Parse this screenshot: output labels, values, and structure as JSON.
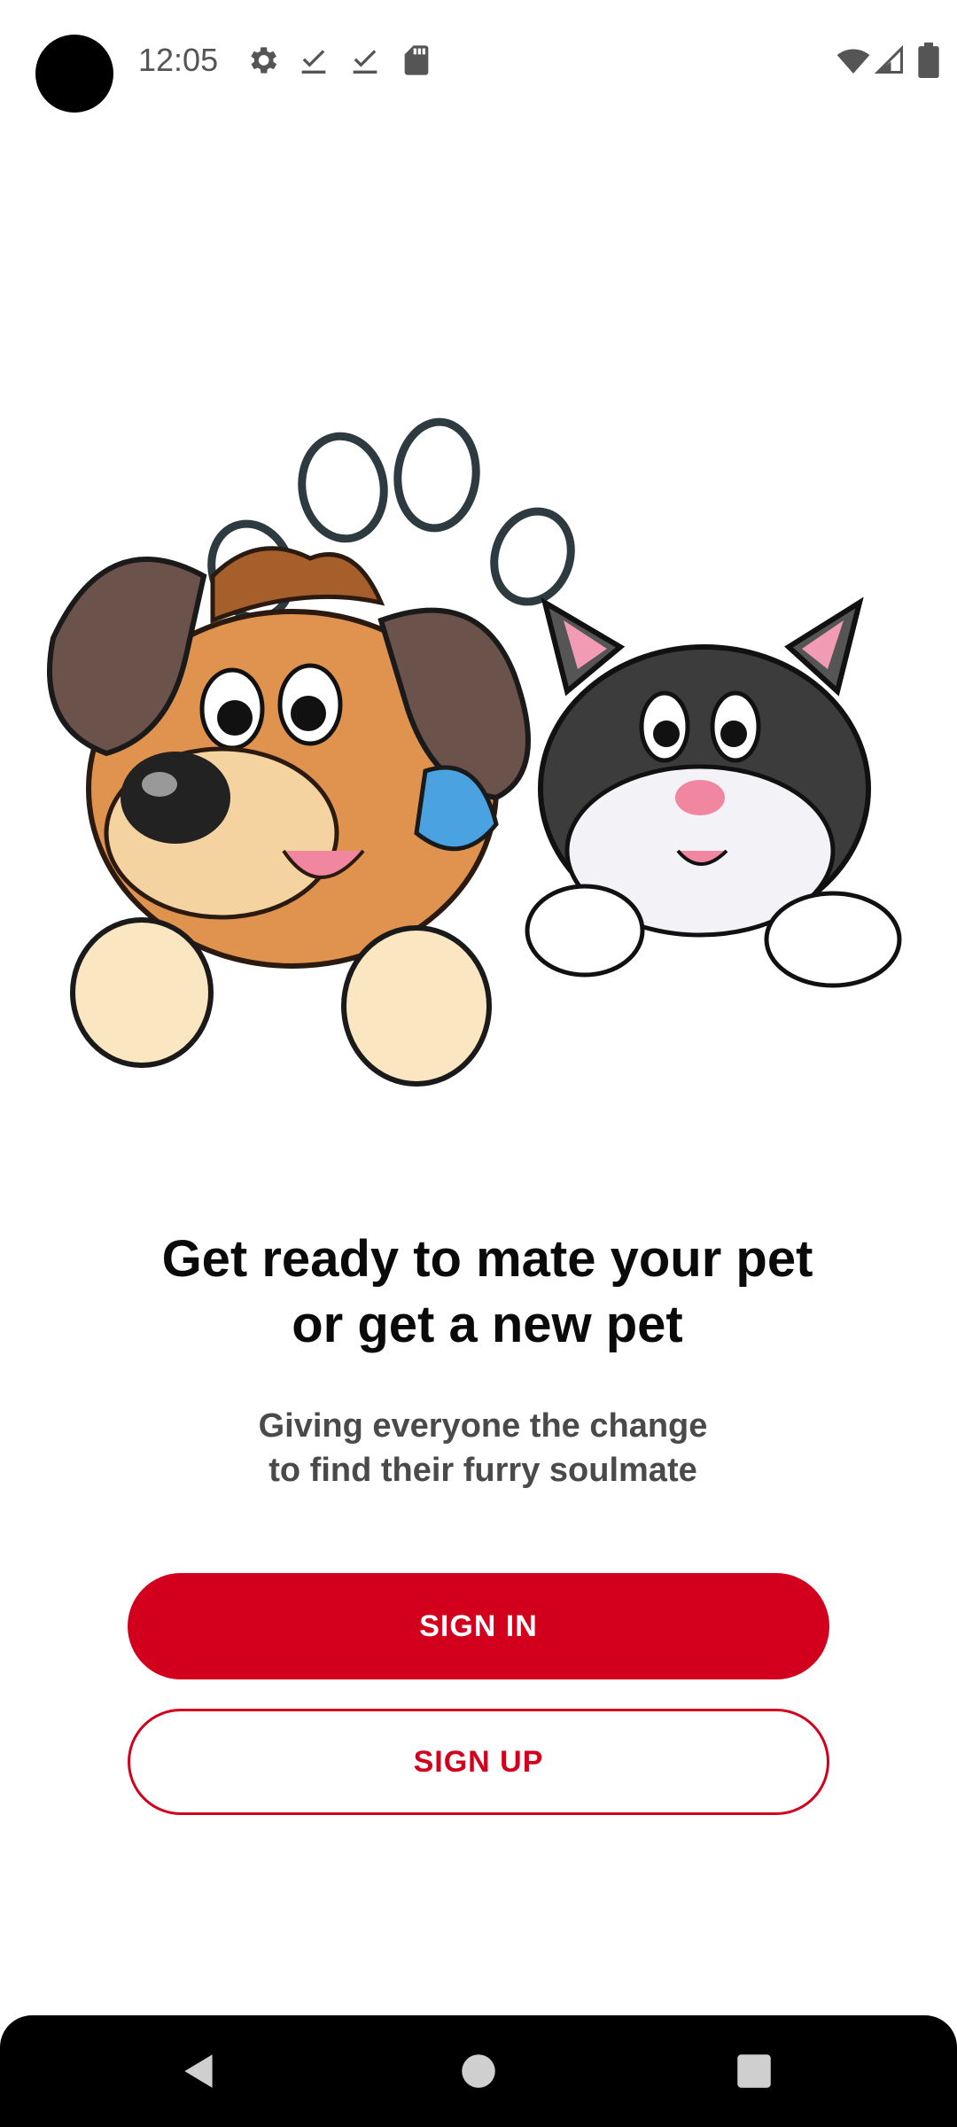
{
  "status_bar": {
    "time": "12:05",
    "icons_left": [
      "settings-icon",
      "download-done-icon",
      "download-done-icon",
      "sd-card-icon"
    ],
    "icons_right": [
      "wifi-icon",
      "signal-icon",
      "battery-icon"
    ]
  },
  "hero": {
    "illustration": "dog-and-cat-with-paw-heart-illustration"
  },
  "content": {
    "headline": "Get ready to mate your pet\n or get a new pet",
    "subtitle": "Giving everyone the change\n to find their furry soulmate"
  },
  "actions": {
    "sign_in_label": "SIGN IN",
    "sign_up_label": "SIGN UP"
  },
  "nav_bar": {
    "buttons": [
      "back-icon",
      "home-icon",
      "recents-icon"
    ]
  },
  "colors": {
    "accent": "#d2001c",
    "headline": "#0a0a0a",
    "subtitle": "#4a4a4a",
    "nav_bar": "#000000"
  }
}
